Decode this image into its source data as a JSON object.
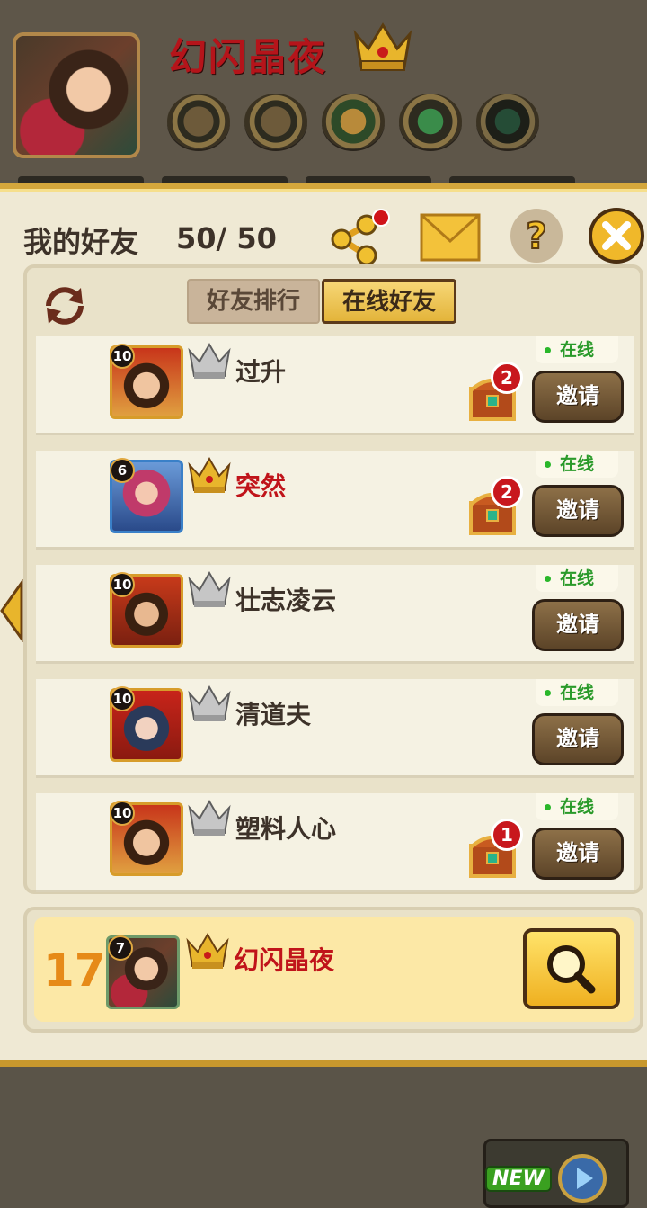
{
  "profile": {
    "name": "幻闪晶夜"
  },
  "panel": {
    "title": "我的好友",
    "count": "50/ 50"
  },
  "tabs": [
    {
      "label": "好友排行",
      "active": false
    },
    {
      "label": "在线好友",
      "active": true
    }
  ],
  "friends": [
    {
      "level": "10",
      "name": "过升",
      "crown": "silver",
      "name_color": "dark",
      "status": "在线",
      "invite": "邀请",
      "gift_count": "2"
    },
    {
      "level": "6",
      "name": "突然",
      "crown": "gold",
      "name_color": "red",
      "status": "在线",
      "invite": "邀请",
      "gift_count": "2"
    },
    {
      "level": "10",
      "name": "壮志凌云",
      "crown": "silver",
      "name_color": "dark",
      "status": "在线",
      "invite": "邀请",
      "gift_count": ""
    },
    {
      "level": "10",
      "name": "清道夫",
      "crown": "silver",
      "name_color": "dark",
      "status": "在线",
      "invite": "邀请",
      "gift_count": ""
    },
    {
      "level": "10",
      "name": "塑料人心",
      "crown": "silver",
      "name_color": "dark",
      "status": "在线",
      "invite": "邀请",
      "gift_count": "1"
    }
  ],
  "my_rank": {
    "rank": "17",
    "level": "7",
    "name": "幻闪晶夜"
  },
  "new_button": {
    "label": "NEW"
  },
  "colors": {
    "accent_gold": "#e3b43a",
    "name_red": "#c0141a",
    "online_green": "#2a9a2a",
    "rank_orange": "#e68a18"
  }
}
